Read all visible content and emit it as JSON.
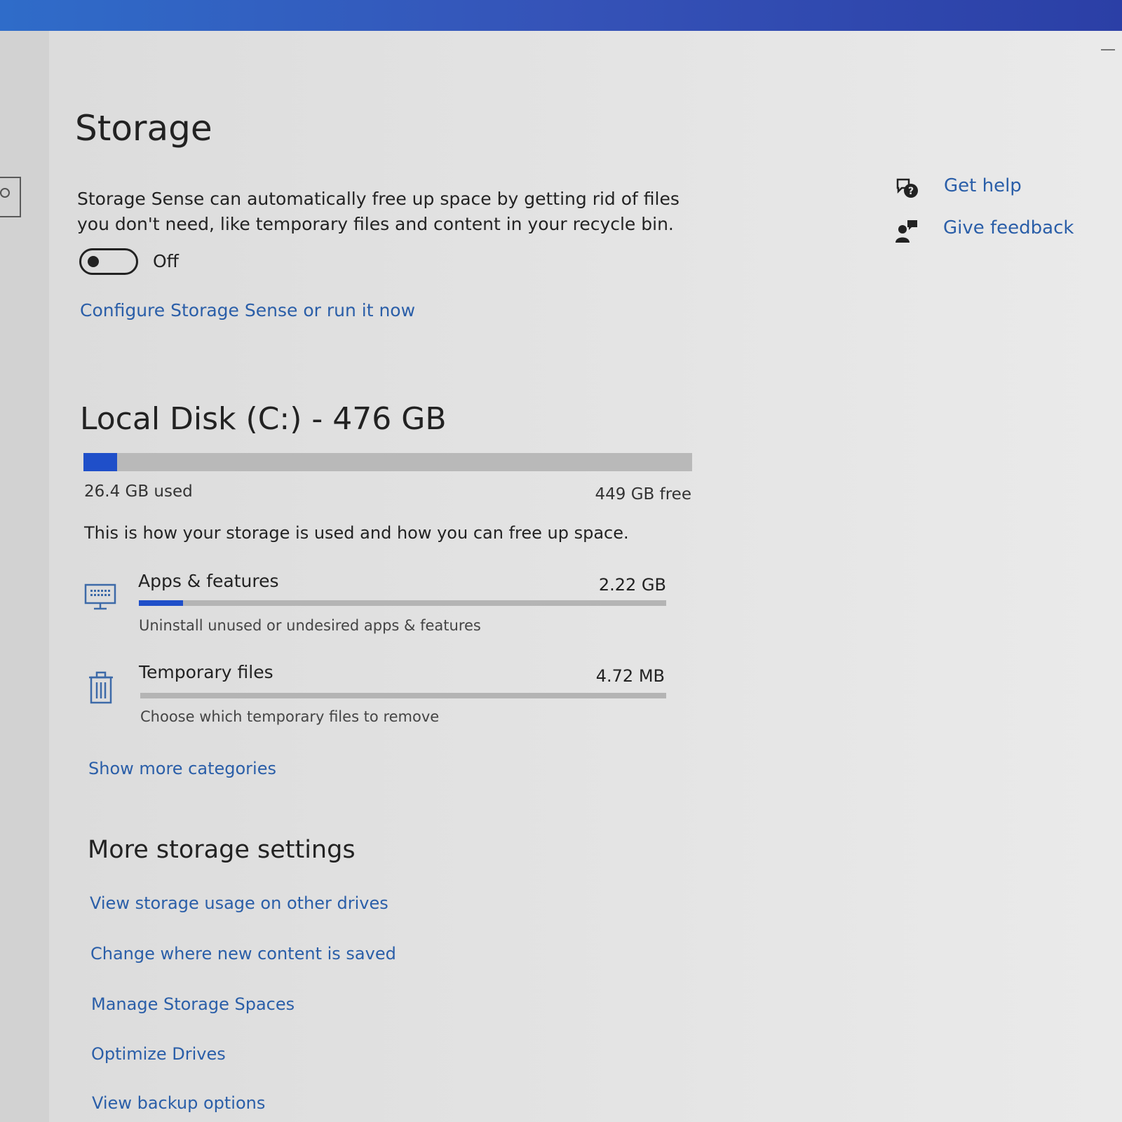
{
  "storage": {
    "title": "Storage",
    "description": "Storage Sense can automatically free up space by getting rid of files you don't need, like temporary files and content in your recycle bin.",
    "toggle_state": "Off",
    "configure_link": "Configure Storage Sense or run it now"
  },
  "disk": {
    "title": "Local Disk (C:) - 476 GB",
    "used_label": "26.4 GB used",
    "free_label": "449 GB free",
    "used_fraction": 0.055,
    "info": "This is how your storage is used and how you can free up space."
  },
  "categories": [
    {
      "label": "Apps & features",
      "size": "2.22 GB",
      "subtitle": "Uninstall unused or undesired apps & features",
      "icon": "monitor-icon",
      "fill_fraction": 0.084
    },
    {
      "label": "Temporary files",
      "size": "4.72 MB",
      "subtitle": "Choose which temporary files to remove",
      "icon": "trash-icon",
      "fill_fraction": 0.0
    }
  ],
  "show_more_link": "Show more categories",
  "more_settings": {
    "title": "More storage settings",
    "links": [
      "View storage usage on other drives",
      "Change where new content is saved",
      "Manage Storage Spaces",
      "Optimize Drives",
      "View backup options"
    ]
  },
  "help": {
    "get_help": "Get help",
    "give_feedback": "Give feedback"
  },
  "colors": {
    "accent": "#1f4fc9",
    "link": "#2a5ea8",
    "titlebar": "#3553b8"
  }
}
